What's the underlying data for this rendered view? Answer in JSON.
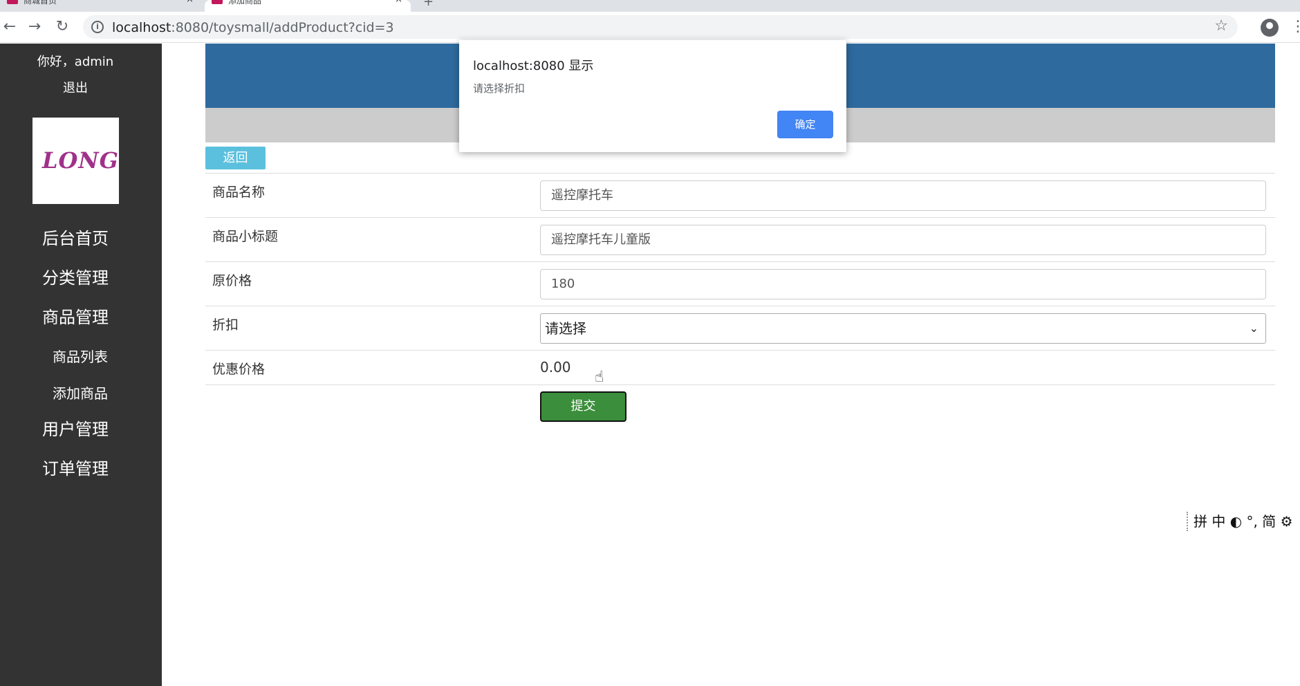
{
  "browser": {
    "tabs": [
      {
        "title": "商城首页",
        "close": "×"
      },
      {
        "title": "添加商品",
        "close": "×"
      }
    ],
    "new_tab": "+",
    "url_host": "localhost",
    "url_rest": ":8080/toysmall/addProduct?cid=3",
    "info_icon": "i",
    "back_icon": "←",
    "forward_icon": "→",
    "reload_icon": "↻",
    "star_icon": "☆",
    "menu_icon": "⋮"
  },
  "sidebar": {
    "greeting": "你好，admin",
    "logout": "退出",
    "logo_text": "LONG",
    "nav": [
      {
        "label": "后台首页"
      },
      {
        "label": "分类管理"
      },
      {
        "label": "商品管理"
      },
      {
        "label": "用户管理"
      },
      {
        "label": "订单管理"
      }
    ],
    "sub_nav": [
      {
        "label": "商品列表"
      },
      {
        "label": "添加商品"
      }
    ]
  },
  "main": {
    "back_label": "返回",
    "form": {
      "name_label": "商品名称",
      "name_value": "遥控摩托车",
      "subtitle_label": "商品小标题",
      "subtitle_value": "遥控摩托车儿童版",
      "price_label": "原价格",
      "price_value": "180",
      "discount_label": "折扣",
      "discount_selected": "请选择",
      "discount_chevron": "⌄",
      "sale_price_label": "优惠价格",
      "sale_price_value": "0.00"
    },
    "submit_label": "提交",
    "cursor_icon": "☝"
  },
  "ime": {
    "text": "拼 中 ◐ °, 简 ⚙"
  },
  "dialog": {
    "title": "localhost:8080 显示",
    "message": "请选择折扣",
    "ok_label": "确定"
  },
  "colors": {
    "sidebar_bg": "#333333",
    "banner_bg": "#2e6a9e",
    "subbar_bg": "#cccccc",
    "back_btn": "#5bc0de",
    "submit_btn": "#3b8e3b",
    "dialog_ok": "#4285f4"
  }
}
